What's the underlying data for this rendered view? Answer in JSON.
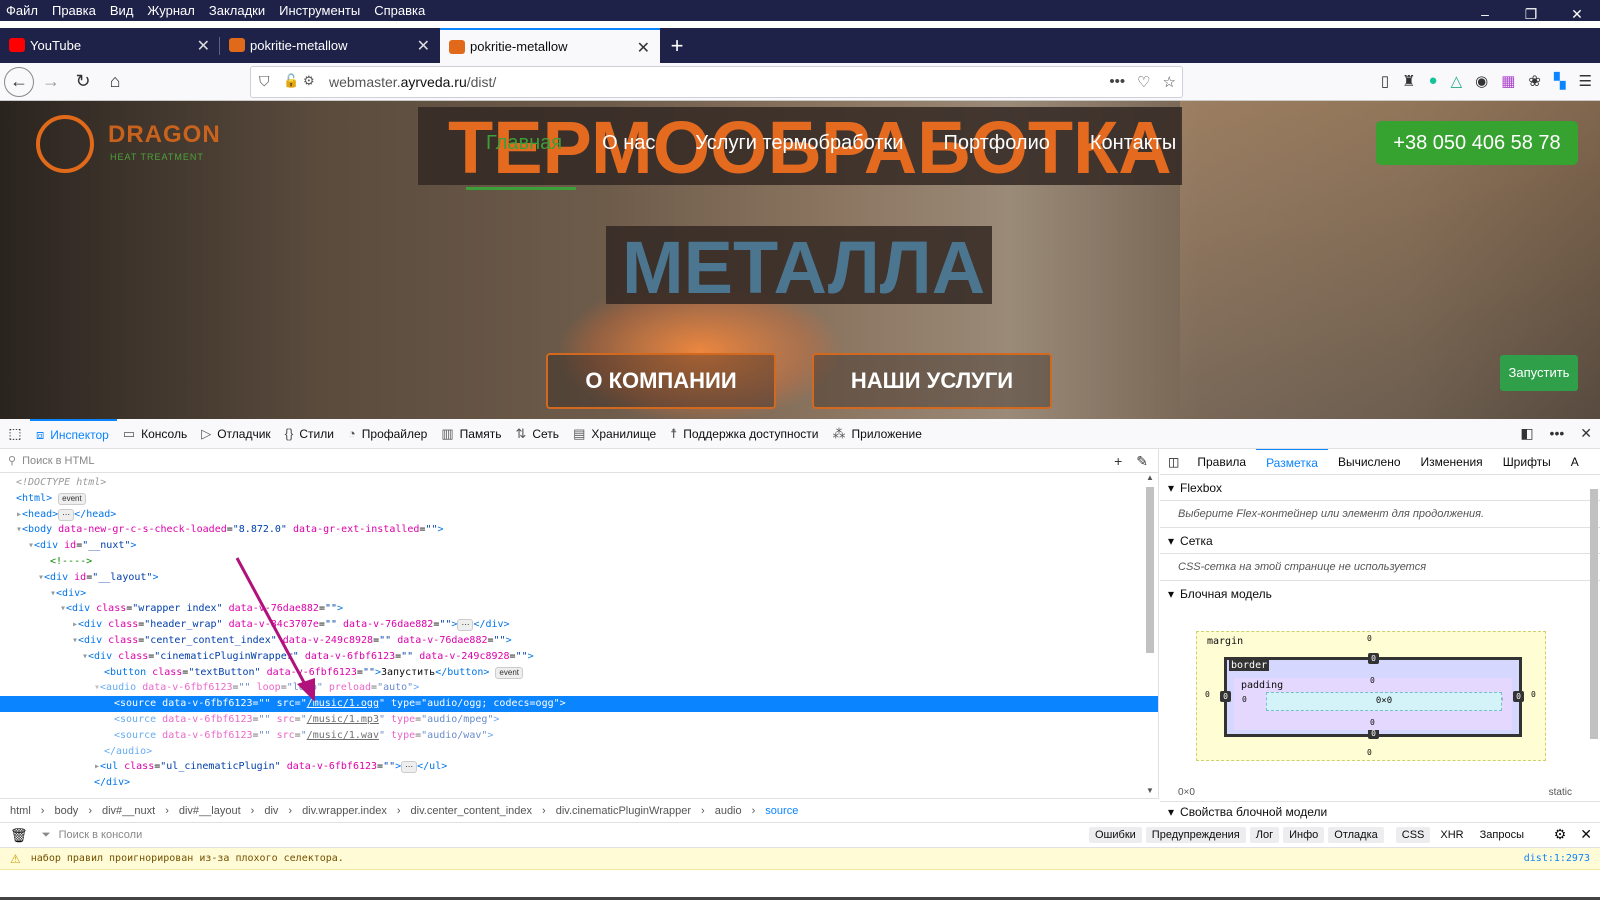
{
  "menubar": [
    "Файл",
    "Правка",
    "Вид",
    "Журнал",
    "Закладки",
    "Инструменты",
    "Справка"
  ],
  "tabs": [
    {
      "title": "YouTube",
      "active": false,
      "icon": "youtube-icon",
      "color": "#ff0000"
    },
    {
      "title": "pokritie-metallow",
      "active": false,
      "icon": "dragon-icon",
      "color": "#e06a1a"
    },
    {
      "title": "pokritie-metallow",
      "active": true,
      "icon": "dragon-icon",
      "color": "#e06a1a"
    }
  ],
  "url": {
    "prefix": "webmaster.",
    "domain": "ayrveda.ru",
    "path": "/dist/"
  },
  "site": {
    "logo": "DRAGON",
    "logo_sub": "HEAT TREATMENT",
    "hero1": "ТЕРМООБРАБОТКА",
    "hero2": "МЕТАЛЛА",
    "menu": [
      "Главная",
      "О нас",
      "Услуги термобработки",
      "Портфолио",
      "Контакты"
    ],
    "phone": "+38 050 406 58 78",
    "cta1": "О КОМПАНИИ",
    "cta2": "НАШИ УСЛУГИ",
    "start": "Запустить"
  },
  "devtools": {
    "tabs": [
      {
        "label": "Инспектор",
        "icon": "inspector-icon",
        "glyph": "⧈",
        "active": true
      },
      {
        "label": "Консоль",
        "icon": "console-icon",
        "glyph": "▭",
        "active": false
      },
      {
        "label": "Отладчик",
        "icon": "debugger-icon",
        "glyph": "▷",
        "active": false
      },
      {
        "label": "Стили",
        "icon": "style-editor-icon",
        "glyph": "{}",
        "active": false
      },
      {
        "label": "Профайлер",
        "icon": "profiler-icon",
        "glyph": "◔",
        "active": false
      },
      {
        "label": "Память",
        "icon": "memory-icon",
        "glyph": "▥",
        "active": false
      },
      {
        "label": "Сеть",
        "icon": "network-icon",
        "glyph": "⇅",
        "active": false
      },
      {
        "label": "Хранилище",
        "icon": "storage-icon",
        "glyph": "▤",
        "active": false
      },
      {
        "label": "Поддержка доступности",
        "icon": "accessibility-icon",
        "glyph": "☨",
        "active": false
      },
      {
        "label": "Приложение",
        "icon": "application-icon",
        "glyph": "⁂",
        "active": false
      }
    ],
    "search_placeholder": "Поиск в HTML",
    "breadcrumbs": [
      "html",
      "body",
      "div#__nuxt",
      "div#__layout",
      "div",
      "div.wrapper.index",
      "div.center_content_index",
      "div.cinematicPluginWrapper",
      "audio",
      "source"
    ],
    "right_tabs": [
      "Правила",
      "Разметка",
      "Вычислено",
      "Изменения",
      "Шрифты",
      "А"
    ],
    "right_active": "Разметка",
    "flexbox": "Flexbox",
    "flexbox_note": "Выберите Flex-контейнер или элемент для продолжения.",
    "grid": "Сетка",
    "grid_note": "CSS-сетка на этой странице не используется",
    "boxmodel": "Блочная модель",
    "boxmodel_props": "Свойства блочной модели",
    "bm": {
      "margin": "margin",
      "border": "border",
      "padding": "padding",
      "content": "0×0",
      "size": "0×0",
      "position": "static",
      "zero": "0"
    },
    "console": {
      "placeholder": "Поиск в консоли",
      "filters": [
        "Ошибки",
        "Предупреждения",
        "Лог",
        "Инфо",
        "Отладка",
        "CSS",
        "XHR",
        "Запросы"
      ],
      "warning": "набор правил проигнорирован из-за плохого селектора.",
      "warning_loc": "dist:1:2973"
    }
  }
}
